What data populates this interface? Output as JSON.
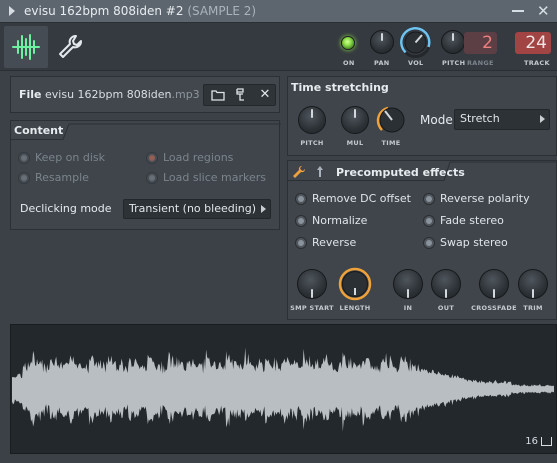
{
  "window": {
    "title": "evisu 162bpm 808iden #2",
    "sample_tag": "(SAMPLE 2)"
  },
  "toolbar": {
    "on_label": "ON",
    "pan_label": "PAN",
    "vol_label": "VOL",
    "pitch_label": "PITCH",
    "range_label": "RANGE",
    "range_value": "2",
    "track_label": "TRACK",
    "track_value": "24",
    "colors": {
      "led": "#8fe14a",
      "accent": "#f0a23a",
      "vol_ring": "#6ec3f0",
      "track_box": "#9c3a3a"
    }
  },
  "file": {
    "label": "File",
    "name": "evisu 162bpm 808iden",
    "ext": ".mp3",
    "buttons": [
      "folder-icon",
      "tree-icon",
      "close-icon"
    ]
  },
  "content": {
    "header": "Content",
    "options": [
      {
        "label": "Keep on disk",
        "checked": false
      },
      {
        "label": "Load regions",
        "checked": true
      },
      {
        "label": "Resample",
        "checked": false
      },
      {
        "label": "Load slice markers",
        "checked": false
      }
    ],
    "declicking_label": "Declicking mode",
    "declicking_value": "Transient (no bleeding)"
  },
  "time_stretching": {
    "header": "Time stretching",
    "knobs": [
      "PITCH",
      "MUL",
      "TIME"
    ],
    "mode_label": "Mode",
    "mode_value": "Stretch"
  },
  "precomputed": {
    "header": "Precomputed effects",
    "effects": [
      {
        "label": "Remove DC offset"
      },
      {
        "label": "Reverse polarity"
      },
      {
        "label": "Normalize"
      },
      {
        "label": "Fade stereo"
      },
      {
        "label": "Reverse"
      },
      {
        "label": "Swap stereo"
      }
    ],
    "knobs": [
      "SMP START",
      "LENGTH",
      "IN",
      "OUT",
      "CROSSFADE",
      "TRIM"
    ]
  },
  "waveform": {
    "number": "16"
  }
}
